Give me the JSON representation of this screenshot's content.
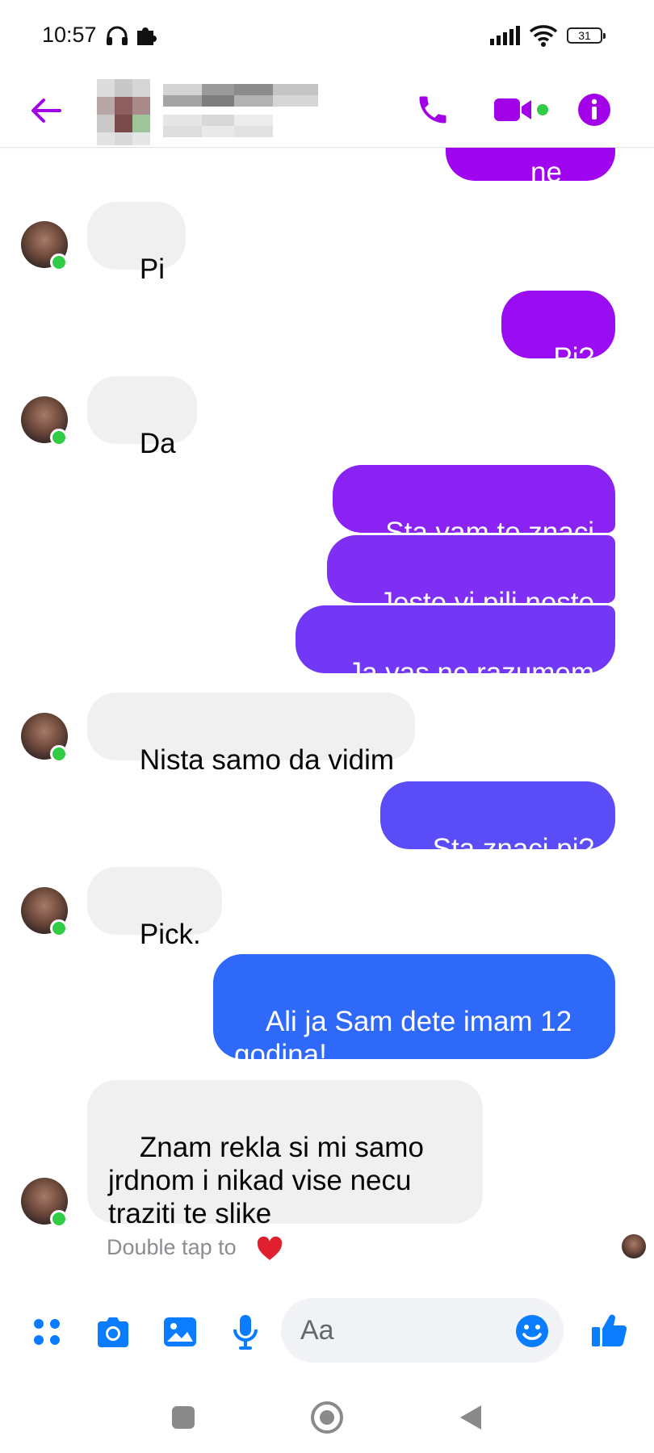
{
  "status_bar": {
    "time": "10:57",
    "battery": "31"
  },
  "header": {
    "icons": [
      "back-arrow-icon",
      "phone-icon",
      "video-camera-icon",
      "info-icon"
    ],
    "accent_color": "#a200e6",
    "online_color": "#31cc46"
  },
  "messages": [
    {
      "from": "me",
      "text": "ne znam",
      "color": "#a005f0"
    },
    {
      "from": "them",
      "text": "Pi"
    },
    {
      "from": "me",
      "text": "Pi?",
      "color": "#9a0cf2"
    },
    {
      "from": "them",
      "text": "Da"
    },
    {
      "from": "me",
      "text": "Sta vam to znaci",
      "color": "#8a22f3"
    },
    {
      "from": "me",
      "text": "Jeste vi pili nesto",
      "color": "#7f2ef4"
    },
    {
      "from": "me",
      "text": "Ja vas ne razumem",
      "color": "#7238f5"
    },
    {
      "from": "them",
      "text": "Nista samo da vidim"
    },
    {
      "from": "me",
      "text": "Sta znaci pi?",
      "color": "#5a4cf6"
    },
    {
      "from": "them",
      "text": "Pick."
    },
    {
      "from": "me",
      "text": "Ali ja Sam dete imam 12 godina!",
      "color": "#2f69f9"
    },
    {
      "from": "them",
      "text": "Znam rekla si mi samo jrdnom i nikad vise necu traziti te slike"
    }
  ],
  "reaction_hint": "Double tap to",
  "composer": {
    "placeholder": "Aa",
    "icons": [
      "apps-grid-icon",
      "camera-icon",
      "image-icon",
      "microphone-icon",
      "emoji-icon",
      "thumbs-up-icon"
    ],
    "accent_color": "#0a7cff"
  },
  "nav_bar": {
    "icons": [
      "recents-square-icon",
      "home-circle-icon",
      "back-triangle-icon"
    ]
  }
}
